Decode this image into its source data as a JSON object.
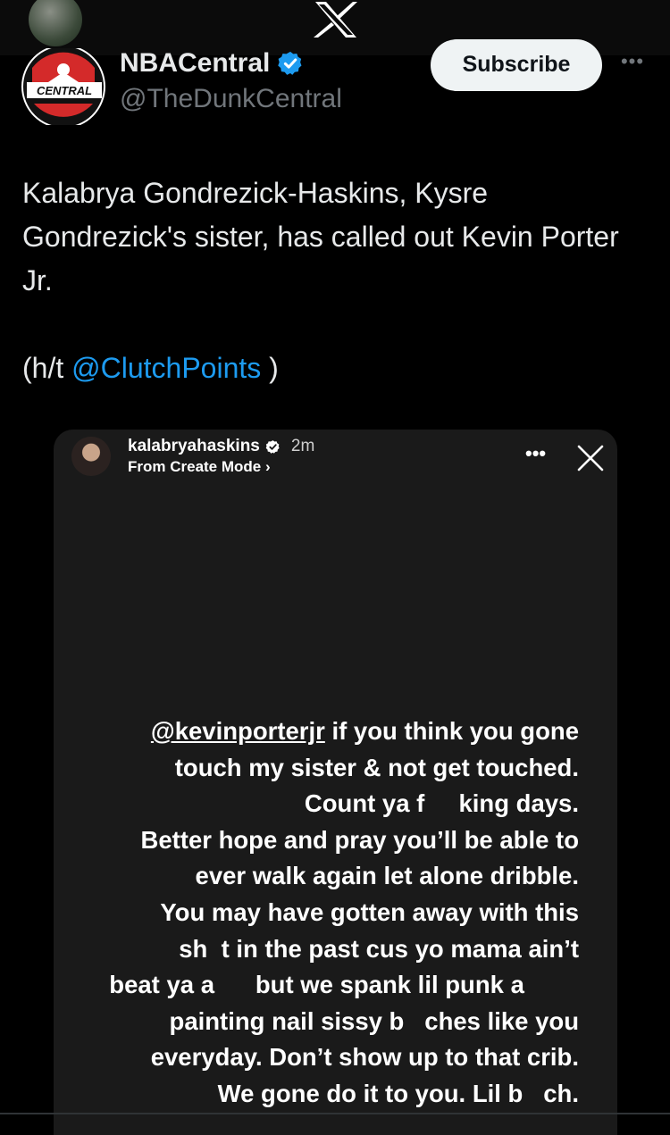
{
  "topbar": {
    "logo_icon": "x-logo-icon"
  },
  "author": {
    "name": "NBACentral",
    "handle": "@TheDunkCentral",
    "avatar_text": "CENTRAL",
    "verified_icon": "verified-badge-icon"
  },
  "actions": {
    "subscribe_label": "Subscribe",
    "more_label": "•••"
  },
  "tweet": {
    "text": "Kalabrya Gondrezick-Haskins, Kysre Gondrezick's sister, has called out Kevin Porter Jr.",
    "credit_prefix": "(h/t ",
    "credit_mention": "@ClutchPoints",
    "credit_suffix": " )"
  },
  "story": {
    "username": "kalabryahaskins",
    "time": "2m",
    "subtitle": "From Create Mode ›",
    "more_label": "•••",
    "mention": "@kevinporterjr",
    "first_line_rest": " if you think you gone",
    "lines": [
      "touch my sister & not get touched.",
      "Count ya f     king days.",
      "Better hope and pray you’ll be able to",
      "ever walk again let alone dribble.",
      "You may have gotten away with this",
      "sh  t in the past cus yo mama ain’t",
      "beat ya a      but we spank lil punk a        ",
      "painting nail sissy b   ches like you",
      "everyday. Don’t show up to that crib.",
      "We gone do it to you. Lil b   ch."
    ]
  },
  "colors": {
    "accent": "#1d9bf0",
    "background": "#000000",
    "secondary_text": "#71767b"
  }
}
